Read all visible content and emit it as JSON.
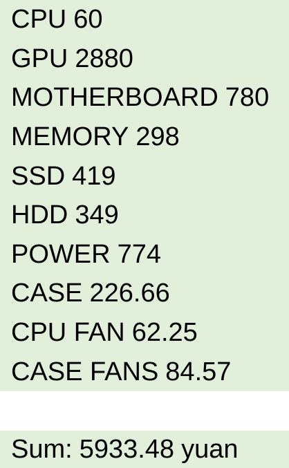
{
  "colors": {
    "cell_background": "#e2efda",
    "text": "#000000",
    "page_background": "#ffffff"
  },
  "items": [
    {
      "name": "CPU",
      "price": "60"
    },
    {
      "name": "GPU",
      "price": "2880"
    },
    {
      "name": "MOTHERBOARD",
      "price": "780"
    },
    {
      "name": "MEMORY",
      "price": "298"
    },
    {
      "name": "SSD",
      "price": "419"
    },
    {
      "name": "HDD",
      "price": "349"
    },
    {
      "name": "POWER",
      "price": "774"
    },
    {
      "name": "CASE",
      "price": "226.66"
    },
    {
      "name": "CPU FAN",
      "price": "62.25"
    },
    {
      "name": "CASE FANS",
      "price": "84.57"
    }
  ],
  "summary": {
    "label": "Sum:",
    "value": "5933.48",
    "unit": "yuan"
  }
}
